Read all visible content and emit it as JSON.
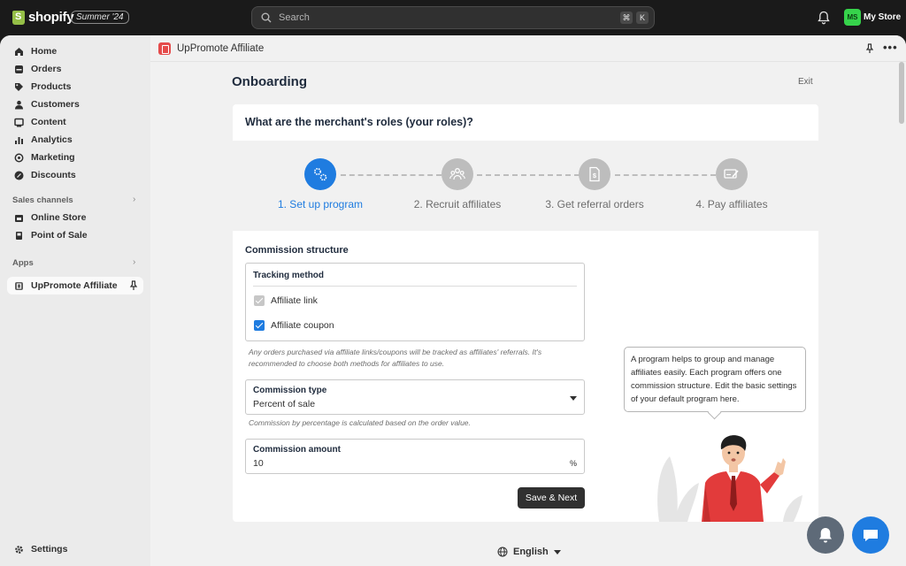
{
  "topbar": {
    "brand": "shopify",
    "edition": "Summer '24",
    "search_placeholder": "Search",
    "shortcut_keys": [
      "⌘",
      "K"
    ],
    "avatar_initials": "MS",
    "store_name": "My Store"
  },
  "sidebar": {
    "items": [
      {
        "label": "Home",
        "icon": "home-icon"
      },
      {
        "label": "Orders",
        "icon": "orders-icon"
      },
      {
        "label": "Products",
        "icon": "tag-icon"
      },
      {
        "label": "Customers",
        "icon": "person-icon"
      },
      {
        "label": "Content",
        "icon": "content-icon"
      },
      {
        "label": "Analytics",
        "icon": "bar-chart-icon"
      },
      {
        "label": "Marketing",
        "icon": "target-icon"
      },
      {
        "label": "Discounts",
        "icon": "discount-icon"
      }
    ],
    "sales_channels_label": "Sales channels",
    "sales_channels": [
      {
        "label": "Online Store",
        "icon": "store-icon"
      },
      {
        "label": "Point of Sale",
        "icon": "pos-icon"
      }
    ],
    "apps_label": "Apps",
    "apps": [
      {
        "label": "UpPromote Affiliate",
        "icon": "app-icon"
      }
    ],
    "settings_label": "Settings"
  },
  "appbar": {
    "title": "UpPromote Affiliate"
  },
  "page": {
    "title": "Onboarding",
    "exit": "Exit",
    "question": "What are the merchant's roles (your roles)?",
    "steps": [
      {
        "label": "1. Set up program",
        "active": true
      },
      {
        "label": "2. Recruit affiliates",
        "active": false
      },
      {
        "label": "3. Get referral orders",
        "active": false
      },
      {
        "label": "4. Pay affiliates",
        "active": false
      }
    ],
    "commission_structure": "Commission structure",
    "tracking": {
      "title": "Tracking method",
      "options": [
        {
          "label": "Affiliate link",
          "checked": true,
          "disabled": true
        },
        {
          "label": "Affiliate coupon",
          "checked": true,
          "disabled": false
        }
      ],
      "help_line1": "Any orders purchased via affiliate links/coupons will be tracked as affiliates' referrals. It's",
      "help_line2": "recommended to choose both methods for affiliates to use."
    },
    "commission_type": {
      "label": "Commission type",
      "value": "Percent of sale",
      "help": "Commission by percentage is calculated based on the order value."
    },
    "commission_amount": {
      "label": "Commission amount",
      "value": "10",
      "suffix": "%"
    },
    "save_button": "Save & Next",
    "tooltip": "A program helps to group and manage affiliates easily. Each program offers one commission structure. Edit the basic settings of your default program here."
  },
  "footer": {
    "language": "English"
  },
  "colors": {
    "accent": "#1f7ce0",
    "fab_notifications": "#5e6a78",
    "fab_chat": "#1f7ce0"
  }
}
